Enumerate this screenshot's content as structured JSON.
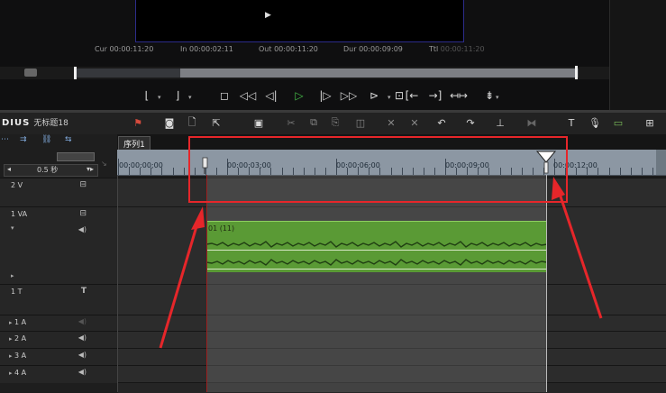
{
  "monitor": {
    "timecodes": [
      {
        "label": "Cur",
        "value": "00:00:11:20"
      },
      {
        "label": "In",
        "value": "00:00:02:11"
      },
      {
        "label": "Out",
        "value": "00:00:11:20"
      },
      {
        "label": "Dur",
        "value": "00:00:09:09"
      },
      {
        "label": "Ttl",
        "value": "00:00:11:20"
      }
    ],
    "play_glyph": "▶︎"
  },
  "transport": {
    "icons": [
      "set-in-icon",
      "set-out-icon",
      "stop-icon",
      "rewind-icon",
      "step-back-icon",
      "play-icon",
      "step-forward-icon",
      "fast-forward-icon",
      "loop-icon",
      "insert-icon",
      "overwrite-icon",
      "split-icon",
      "export-icon"
    ]
  },
  "app": {
    "name": "DIUS",
    "project": "无标题18"
  },
  "zoom": {
    "value": "0.5 秒"
  },
  "sequence": {
    "tab_label": "序列1"
  },
  "ruler": {
    "labels": [
      "00:00:00;00",
      "00:00:03;00",
      "00:00:06;00",
      "00:00:09;00",
      "00:00:12;00"
    ]
  },
  "tracks": [
    {
      "name": "2 V",
      "icon": "⊟"
    },
    {
      "name": "1 VA",
      "icon": "⊟",
      "icon2": "◀)"
    },
    {
      "name": "1 T",
      "icon": "T"
    },
    {
      "name": "1 A",
      "icon": "◀)"
    },
    {
      "name": "2 A",
      "icon": "◀)"
    },
    {
      "name": "3 A",
      "icon": "◀)"
    },
    {
      "name": "4 A",
      "icon": "◀)"
    }
  ],
  "clip": {
    "label": "01 (11)"
  },
  "colors": {
    "ruler": "#8c97a3",
    "clip_audio": "#5a9a35",
    "annotation": "#e6262a",
    "play": "#47c24a"
  }
}
